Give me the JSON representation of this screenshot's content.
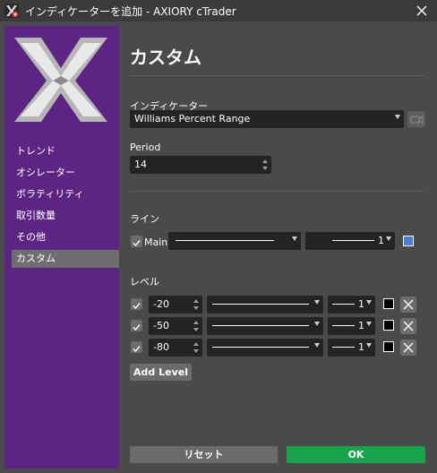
{
  "window": {
    "title": "インディケーターを追加 - AXIORY cTrader"
  },
  "colors": {
    "sidebar": "#5c2483",
    "panel": "#4a4a4a",
    "field": "#232323",
    "ok_button": "#16a34a",
    "reset_button": "#6b6b6b",
    "line_color_swatch": "#4a7fd4",
    "level_color_swatch": "#000000"
  },
  "sidebar": {
    "logo_icon": "axiory-x-logo",
    "items": [
      {
        "label": "トレンド"
      },
      {
        "label": "オシレーター"
      },
      {
        "label": "ボラティリティ"
      },
      {
        "label": "取引数量"
      },
      {
        "label": "その他"
      },
      {
        "label": "カスタム",
        "active": true
      }
    ]
  },
  "main": {
    "title": "カスタム",
    "indicator": {
      "label": "インディケーター",
      "value": "Williams Percent Range"
    },
    "period": {
      "label": "Period",
      "value": "14"
    },
    "lines": {
      "section_label": "ライン",
      "items": [
        {
          "label": "Main",
          "checked": true,
          "width": "1",
          "color": "#4a7fd4"
        }
      ]
    },
    "levels": {
      "section_label": "レベル",
      "items": [
        {
          "value": "-20",
          "checked": true,
          "width": "1",
          "color": "#000000"
        },
        {
          "value": "-50",
          "checked": true,
          "width": "1",
          "color": "#000000"
        },
        {
          "value": "-80",
          "checked": true,
          "width": "1",
          "color": "#000000"
        }
      ],
      "add_label": "Add Level"
    },
    "reset_label": "リセット",
    "ok_label": "OK"
  }
}
